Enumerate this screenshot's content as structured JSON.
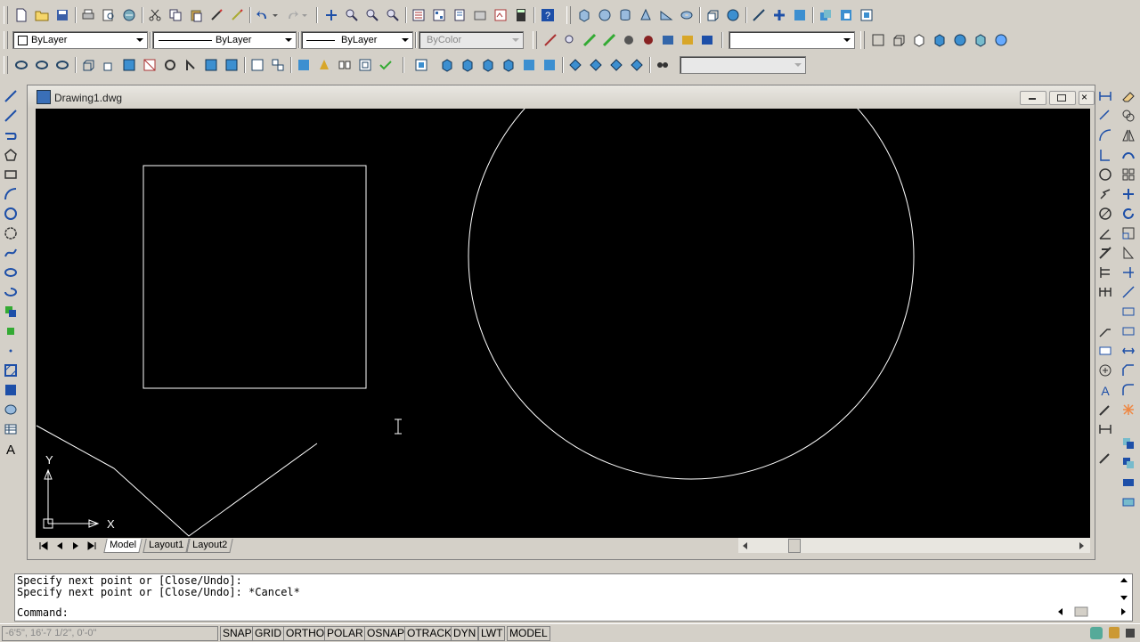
{
  "toolbars": {
    "standard_icons": [
      "new-icon",
      "open-icon",
      "save-icon",
      "plot-icon",
      "plot-preview-icon",
      "publish-icon",
      "cut-icon",
      "copy-icon",
      "paste-icon",
      "match-properties-icon",
      "block-editor-icon",
      "undo-icon",
      "redo-icon",
      "pan-icon",
      "zoom-realtime-icon",
      "zoom-window-icon",
      "zoom-previous-icon",
      "properties-icon",
      "design-center-icon",
      "tool-palettes-icon",
      "sheet-set-icon",
      "markup-icon",
      "quickcalc-icon",
      "help-icon"
    ],
    "layer_color": "ByLayer",
    "layer_linetype": "ByLayer",
    "layer_lineweight": "ByLayer",
    "plot_style": "ByColor",
    "plot_style_disabled": true
  },
  "document": {
    "title": "Drawing1.dwg",
    "minimize": "minimize-icon",
    "restore": "restore-icon",
    "close": "close-icon"
  },
  "ucs": {
    "x_label": "X",
    "y_label": "Y"
  },
  "layout_tabs": [
    {
      "label": "Model",
      "active": true
    },
    {
      "label": "Layout1",
      "active": false
    },
    {
      "label": "Layout2",
      "active": false
    }
  ],
  "command": {
    "history": [
      "Specify next point or [Close/Undo]:",
      "Specify next point or [Close/Undo]: *Cancel*"
    ],
    "prompt": "Command:"
  },
  "status": {
    "coordinates": "-6'5\", 16'-7 1/2\", 0'-0\"",
    "toggles": [
      "SNAP",
      "GRID",
      "ORTHO",
      "POLAR",
      "OSNAP",
      "OTRACK",
      "DYN",
      "LWT",
      "MODEL"
    ]
  },
  "colors": {
    "canvas": "#000000",
    "geometry": "#ffffff",
    "chrome": "#d4d0c8"
  }
}
